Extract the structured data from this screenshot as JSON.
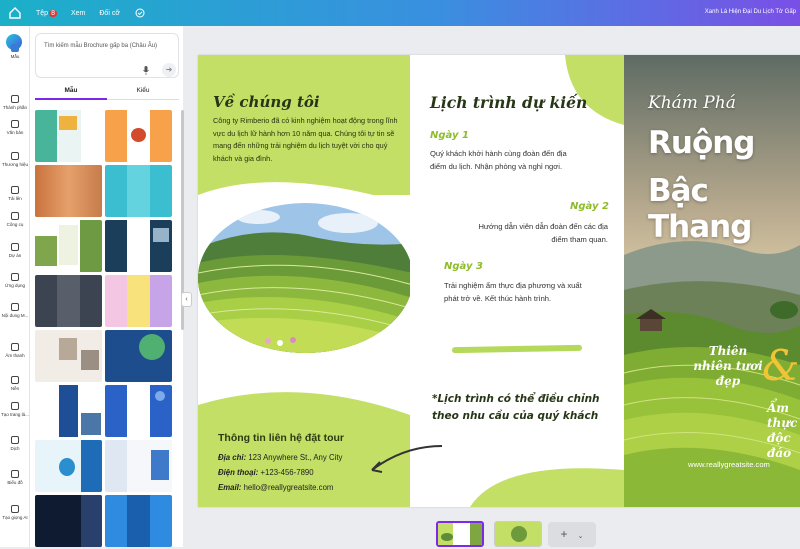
{
  "topbar": {
    "menu": [
      "Tệp",
      "Xem",
      "Đối cỡ"
    ],
    "file_badge": "8",
    "doc_title": "Xanh Lá Hiện Đại Du Lịch Tờ Gấp"
  },
  "rail": {
    "items": [
      "Mẫu",
      "Thành phần",
      "Văn bản",
      "Thương hiệu",
      "Tải lên",
      "Công cụ",
      "Dự án",
      "Ứng dụng",
      "Nội dung M...",
      "Âm thanh",
      "Nền",
      "Tạo trang lá...",
      "Dịch",
      "Biểu đồ",
      "Tạo giọng AI"
    ]
  },
  "panel": {
    "search_placeholder": "Tìm kiếm mẫu Brochure gấp ba (Châu Âu)",
    "tabs": [
      "Mẫu",
      "Kiểu"
    ]
  },
  "brochure": {
    "about_title": "Về chúng tôi",
    "about_body": "Công ty Rimberio đã có kinh nghiệm hoạt động trong lĩnh vực du lịch lữ hành hơn 10 năm qua. Chúng tôi tự tin sẽ mang đến những trải nghiệm du lịch tuyệt vời cho quý khách và gia đình.",
    "contact_title": "Thông tin liên hệ đặt tour",
    "address_label": "Địa chỉ:",
    "address": "123 Anywhere St., Any City",
    "phone_label": "Điện thoại:",
    "phone": "+123-456-7890",
    "email_label": "Email:",
    "email": "hello@reallygreatsite.com",
    "schedule_title": "Lịch trình dự kiến",
    "day1": "Ngày 1",
    "day1_text": "Quý khách khởi hành cùng đoàn đến địa điểm du lịch. Nhận phòng và nghỉ ngơi.",
    "day2": "Ngày 2",
    "day2_text": "Hướng dẫn viên dẫn đoàn đến các địa điểm tham quan.",
    "day3": "Ngày 3",
    "day3_text": "Trải nghiệm ẩm thực địa phương và xuất phát trở về. Kết thúc hành trình.",
    "note": "*Lịch trình có thể điều chỉnh theo nhu cầu của quý khách",
    "cover_kicker": "Khám Phá",
    "cover_line1": "Ruộng",
    "cover_line2": "Bậc Thang",
    "cover_tag1": "Thiên nhiên tươi đẹp",
    "cover_amp": "&",
    "cover_tag2": "Ẩm thực độc đáo",
    "cover_web": "www.reallygreatsite.com"
  },
  "pager": {
    "add_label": "+",
    "more_icon": "chevron-down-icon"
  },
  "colors": {
    "accent": "#7d2ae8",
    "lime": "#c3df66",
    "dark_green": "#273616"
  }
}
